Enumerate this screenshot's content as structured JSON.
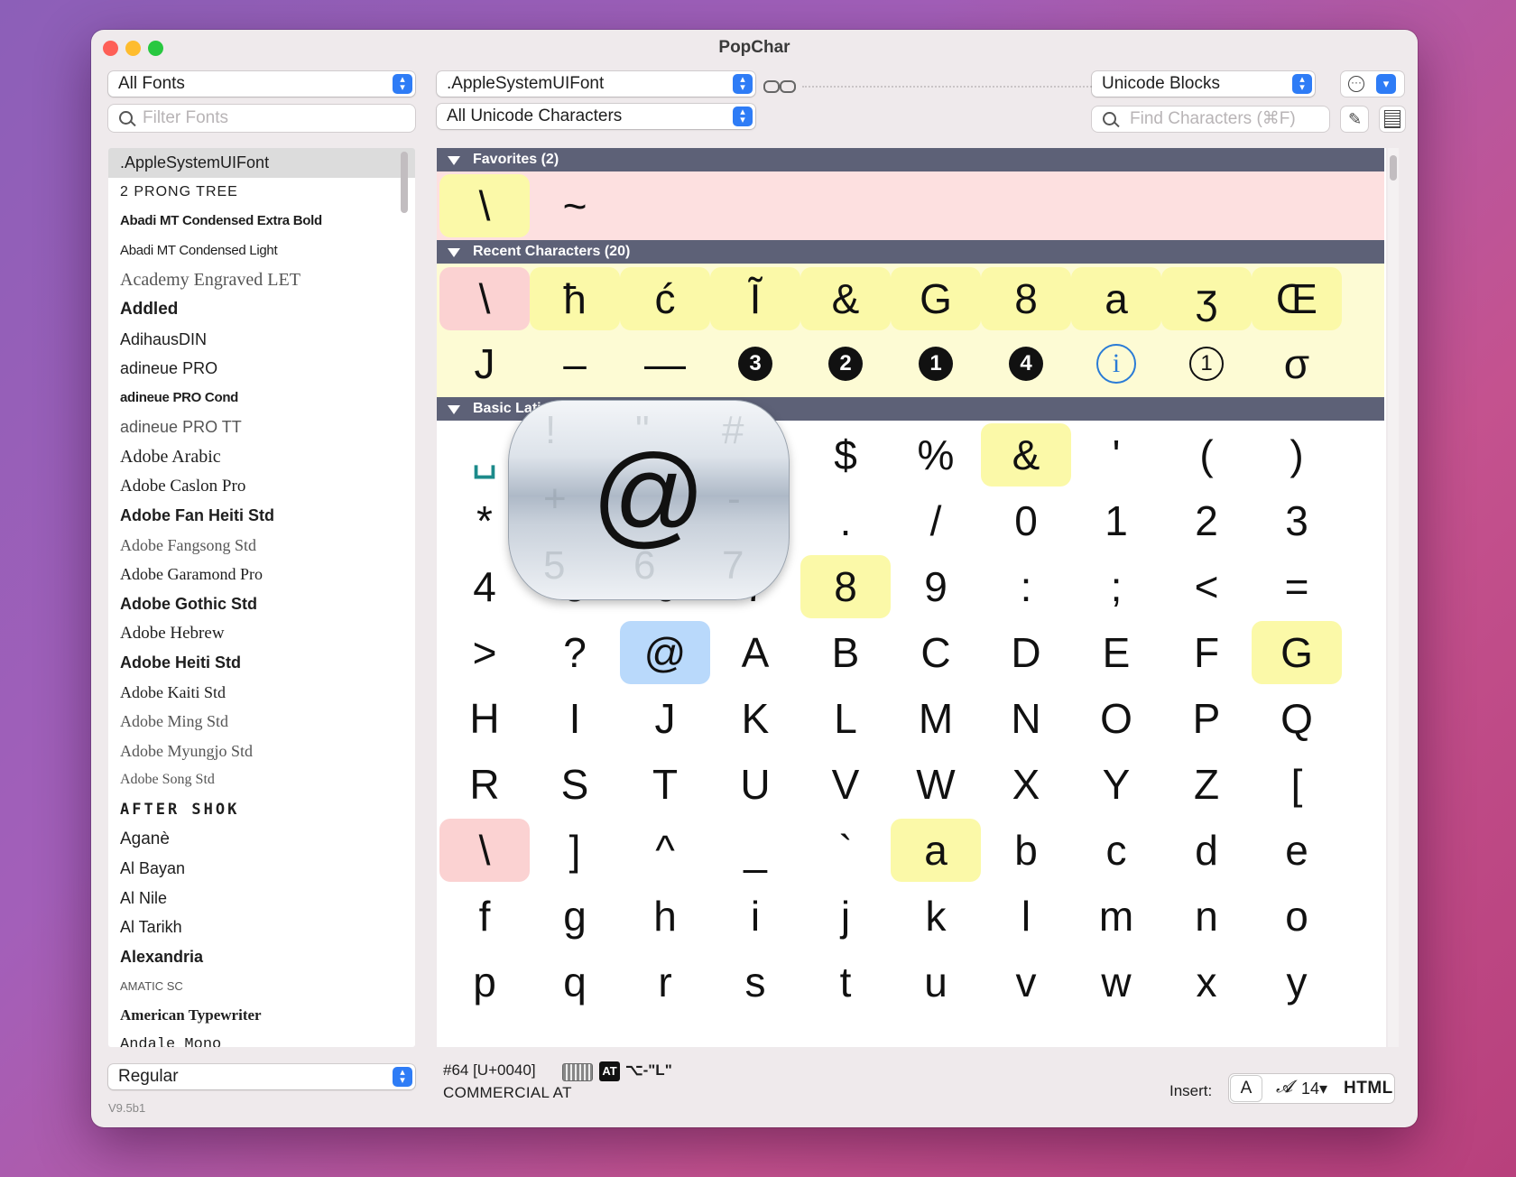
{
  "window": {
    "title": "PopChar"
  },
  "toolbar": {
    "font_collection": "All Fonts",
    "filter_placeholder": "Filter Fonts",
    "current_font": ".AppleSystemUIFont",
    "character_set": "All Unicode Characters",
    "view_mode": "Unicode Blocks",
    "find_placeholder": "Find Characters (⌘F)"
  },
  "fonts": [
    ".AppleSystemUIFont",
    "2 PRONG TREE",
    "Abadi MT Condensed Extra Bold",
    "Abadi MT Condensed Light",
    "Academy Engraved LET",
    "Addled",
    "AdihausDIN",
    "adineue PRO",
    "adineue PRO Cond",
    "adineue PRO TT",
    "Adobe Arabic",
    "Adobe Caslon Pro",
    "Adobe Fan Heiti Std",
    "Adobe Fangsong Std",
    "Adobe Garamond Pro",
    "Adobe Gothic Std",
    "Adobe Hebrew",
    "Adobe Heiti Std",
    "Adobe Kaiti Std",
    "Adobe Ming Std",
    "Adobe Myungjo Std",
    "Adobe Song Std",
    "AFTER SHOK",
    "Aganè",
    "Al Bayan",
    "Al Nile",
    "Al Tarikh",
    "Alexandria",
    "AMATIC SC",
    "American Typewriter",
    "Andale Mono"
  ],
  "style_select": "Regular",
  "version": "V9.5b1",
  "sections": {
    "favorites": "Favorites (2)",
    "recent": "Recent Characters (20)",
    "basic_latin": "Basic Latin (95)"
  },
  "favorites": [
    "\\",
    "~"
  ],
  "recent_row1": [
    "\\",
    "ħ",
    "ć",
    "Ĩ",
    "&",
    "G",
    "8",
    "a",
    "ʒ",
    "Œ"
  ],
  "recent_row2": [
    "J",
    "–",
    "—",
    "3",
    "2",
    "1",
    "4",
    "i",
    "1",
    "σ"
  ],
  "basic_latin": [
    [
      "␣",
      "!",
      "\"",
      "#",
      "$",
      "%",
      "&",
      "'",
      "(",
      ")"
    ],
    [
      "*",
      "+",
      ",",
      "-",
      ".",
      "/",
      "0",
      "1",
      "2",
      "3"
    ],
    [
      "4",
      "5",
      "6",
      "7",
      "8",
      "9",
      ":",
      ";",
      "<",
      "="
    ],
    [
      ">",
      "?",
      "@",
      "A",
      "B",
      "C",
      "D",
      "E",
      "F",
      "G"
    ],
    [
      "H",
      "I",
      "J",
      "K",
      "L",
      "M",
      "N",
      "O",
      "P",
      "Q"
    ],
    [
      "R",
      "S",
      "T",
      "U",
      "V",
      "W",
      "X",
      "Y",
      "Z",
      "["
    ],
    [
      "\\",
      "]",
      "^",
      "_",
      "`",
      "a",
      "b",
      "c",
      "d",
      "e"
    ],
    [
      "f",
      "g",
      "h",
      "i",
      "j",
      "k",
      "l",
      "m",
      "n",
      "o"
    ],
    [
      "p",
      "q",
      "r",
      "s",
      "t",
      "u",
      "v",
      "w",
      "x",
      "y"
    ]
  ],
  "magnifier": {
    "char": "@",
    "neighbors": [
      "!",
      "\"",
      "#",
      "+",
      "-",
      "5",
      "6",
      "7"
    ]
  },
  "status": {
    "code": "#64 [U+0040]",
    "name": "COMMERCIAL AT",
    "badge": "AT",
    "shortcut": "⌥-\"L\""
  },
  "insert": {
    "label": "Insert:",
    "mode": "A",
    "font_format_icon": "𝓐",
    "size": "14▾",
    "html": "HTML"
  },
  "colors": {
    "accent": "#2e7cf6",
    "section_header": "#5d6177",
    "highlight_yellow": "#fbf9a8",
    "highlight_pink": "#fbd2d2",
    "highlight_blue": "#b9d9fb",
    "favorites_band": "#fde0e0",
    "recent_band": "#fdfbd4"
  }
}
